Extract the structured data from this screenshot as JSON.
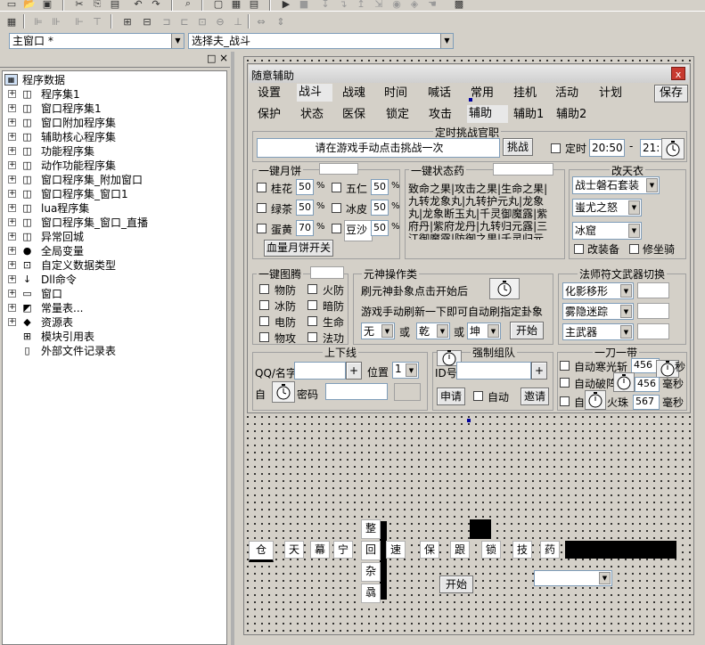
{
  "toolbar": {
    "icons_row1": [
      "new-doc-icon",
      "open-icon",
      "save-icon",
      "cut-icon",
      "copy-icon",
      "paste-icon",
      "undo-icon",
      "redo-icon",
      "preview-icon",
      "frame-icon",
      "table-icon",
      "run-icon",
      "stop-icon",
      "step-icon",
      "step-into-icon",
      "step-out-icon",
      "bookmark-icon",
      "lock-icon"
    ],
    "icons_row2": [
      "form-icon",
      "align-left-icon",
      "align-center-icon",
      "align-right-icon",
      "align-top-icon",
      "align-middle-icon",
      "align-bottom-icon",
      "center-h-icon",
      "center-v-icon",
      "same-width-icon",
      "same-height-icon",
      "same-size-icon",
      "space-h-icon",
      "space-v-icon"
    ]
  },
  "selectors": {
    "window_combo": "主窗口 *",
    "control_combo": "选择夫_战斗"
  },
  "panel": {
    "pin": "□",
    "close": "×"
  },
  "tree": {
    "root": "程序数据",
    "items": [
      {
        "label": "程序集1",
        "icon": "module-icon"
      },
      {
        "label": "窗口程序集1",
        "icon": "module-icon"
      },
      {
        "label": "窗口附加程序集",
        "icon": "module-icon"
      },
      {
        "label": "辅助核心程序集",
        "icon": "module-icon"
      },
      {
        "label": "功能程序集",
        "icon": "module-icon"
      },
      {
        "label": "动作功能程序集",
        "icon": "module-icon"
      },
      {
        "label": "窗口程序集_附加窗口",
        "icon": "module-icon"
      },
      {
        "label": "窗口程序集_窗口1",
        "icon": "module-icon"
      },
      {
        "label": "lua程序集",
        "icon": "module-icon"
      },
      {
        "label": "窗口程序集_窗口_直播",
        "icon": "module-icon"
      },
      {
        "label": "异常回城",
        "icon": "module-icon"
      },
      {
        "label": "全局变量",
        "icon": "variable-icon"
      },
      {
        "label": "自定义数据类型",
        "icon": "datatype-icon"
      },
      {
        "label": "Dll命令",
        "icon": "dll-icon"
      },
      {
        "label": "窗口",
        "icon": "window-icon"
      },
      {
        "label": "常量表...",
        "icon": "constant-icon"
      },
      {
        "label": "资源表",
        "icon": "resource-icon"
      },
      {
        "label": "模块引用表",
        "icon": "module-ref-icon"
      },
      {
        "label": "外部文件记录表",
        "icon": "file-icon"
      }
    ]
  },
  "form": {
    "title": "随意辅助",
    "close": "x",
    "tabs_row1": [
      "设置",
      "战斗",
      "战魂",
      "时间",
      "喊话",
      "常用",
      "挂机",
      "活动",
      "计划"
    ],
    "save_button": "保存",
    "tabs_row2": [
      "保护",
      "状态",
      "医保",
      "锁定",
      "攻击",
      "辅助",
      "辅助1",
      "辅助2"
    ],
    "timed_challenge": {
      "title": "定时挑战官职",
      "hint": "请在游戏手动点击挑战一次",
      "challenge_button": "挑战",
      "timer_label": "定时",
      "time_value": "20:50",
      "dash": "-",
      "second_value": "21:"
    },
    "mooncake": {
      "title": "一键月饼",
      "items": [
        {
          "label": "桂花",
          "value": "50",
          "unit": "%"
        },
        {
          "label": "五仁",
          "value": "50",
          "unit": "%"
        },
        {
          "label": "绿茶",
          "value": "50",
          "unit": "%"
        },
        {
          "label": "冰皮",
          "value": "50",
          "unit": "%"
        },
        {
          "label": "蛋黄",
          "value": "70",
          "unit": "%"
        },
        {
          "label": "豆沙",
          "value": "50",
          "unit": "%"
        }
      ],
      "toggle_button": "血量月饼开关"
    },
    "status_potion": {
      "title": "一键状态药",
      "text": "致命之果|攻击之果|生命之果|九转龙象丸|九转护元丸|龙象丸|龙象断玉丸|千灵御魔露|紫府丹|紫府龙丹|九转归元露|三江御魔露|防御之果|千灵归元露|"
    },
    "change_clothes": {
      "title": "改天衣",
      "sel1": "战士磐石套装",
      "sel2": "蚩尤之怒",
      "sel3": "冰窟",
      "cb1": "改装备",
      "cb2": "修坐骑"
    },
    "totem": {
      "title": "一键图腾",
      "items": [
        "物防",
        "火防",
        "冰防",
        "暗防",
        "电防",
        "生命",
        "物攻",
        "法功"
      ]
    },
    "spirit": {
      "title": "元神操作类",
      "line1": "刷元神卦象点击开始后",
      "line2": "游戏手动刷新一下即可自动刷指定卦象",
      "sel1": "无",
      "or1": "或",
      "sel2": "乾",
      "or2": "或",
      "sel3": "坤",
      "start": "开始"
    },
    "weapon": {
      "title": "法师符文武器切换",
      "sel1": "化影移形",
      "sel2": "雾隐迷踪",
      "sel3": "主武器"
    },
    "login": {
      "title": "上下线",
      "qq_label": "QQ/名字",
      "plus": "+",
      "pos_label": "位置",
      "pos_value": "1",
      "auto_label": "自",
      "pwd_label": "密码"
    },
    "team": {
      "title": "强制组队",
      "id_label": "ID号",
      "plus": "+",
      "apply": "申请",
      "auto": "自动",
      "invite": "邀请"
    },
    "one_blade": {
      "title": "一刀一带",
      "r1_label": "自动寒光斩",
      "r1_value": "456",
      "r1_unit": "秒",
      "r2_label": "自动破阵",
      "r2_value": "456",
      "r2_unit": "毫秒",
      "r3_prefix": "自",
      "r3_label": "火珠",
      "r3_value": "567",
      "r3_unit": "毫秒"
    }
  },
  "canvas": {
    "vert_buttons": [
      "整",
      "回",
      "杂",
      "骉"
    ],
    "buttons": [
      "仓",
      "天",
      "幕",
      "宁",
      "速",
      "保",
      "跟",
      "锁",
      "技",
      "药"
    ],
    "start": "开始"
  }
}
